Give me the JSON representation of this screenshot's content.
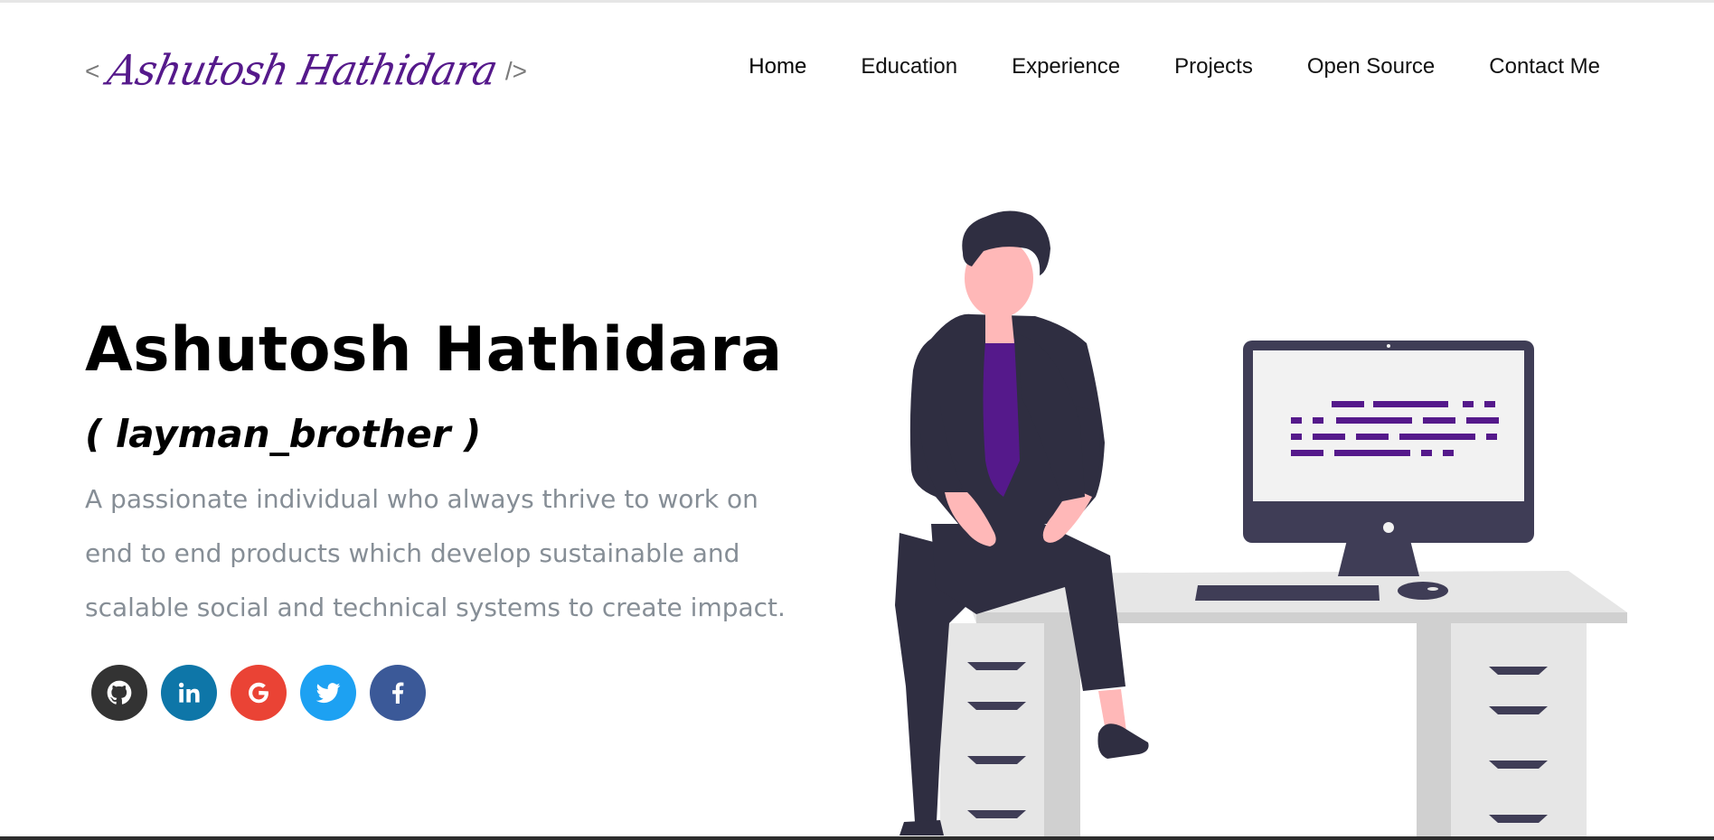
{
  "header": {
    "logo_open": "<",
    "logo_name": "Ashutosh Hathidara",
    "logo_close": "/>",
    "nav": [
      {
        "label": "Home"
      },
      {
        "label": "Education"
      },
      {
        "label": "Experience"
      },
      {
        "label": "Projects"
      },
      {
        "label": "Open Source"
      },
      {
        "label": "Contact Me"
      }
    ]
  },
  "hero": {
    "title": "Ashutosh Hathidara",
    "subtitle": "( layman_brother )",
    "description": "A passionate individual who always thrive to work on end to end products which develop sustainable and scalable social and technical systems to create impact."
  },
  "socials": [
    {
      "icon": "github-icon",
      "color": "#333333"
    },
    {
      "icon": "linkedin-icon",
      "color": "#0e76a8"
    },
    {
      "icon": "google-icon",
      "color": "#ea4335"
    },
    {
      "icon": "twitter-icon",
      "color": "#1da1f2"
    },
    {
      "icon": "facebook-icon",
      "color": "#3b5998"
    }
  ],
  "colors": {
    "accent": "#55198b",
    "text_muted": "#868e96",
    "figure_dark": "#2f2e41",
    "skin": "#ffb8b8",
    "desk": "#e6e6e6"
  }
}
